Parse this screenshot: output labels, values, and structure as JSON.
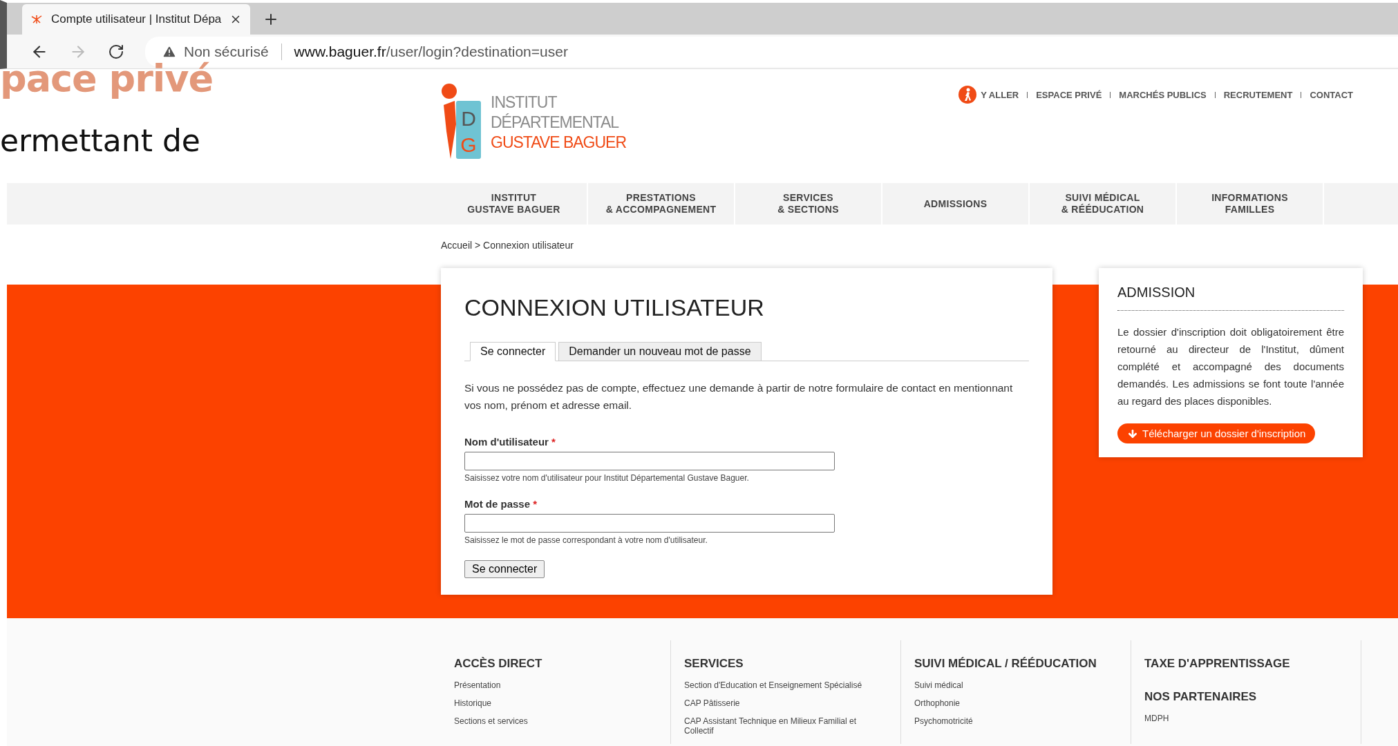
{
  "browser": {
    "tab_title": "Compte utilisateur | Institut Dépa",
    "security_label": "Non sécurisé",
    "url_host": "www.baguer.fr",
    "url_path": "/user/login?destination=user"
  },
  "slide_fragments": {
    "heading": "pace privé",
    "text": "ermettant de"
  },
  "logo": {
    "line_1": "INSTITUT",
    "line_2": "DÉPARTEMENTAL",
    "line_3": "GUSTAVE BAGUER",
    "letter_1": "D",
    "letter_2": "G"
  },
  "top_links": [
    {
      "label": "Y ALLER",
      "kind": "icon"
    },
    {
      "label": "ESPACE PRIVÉ",
      "kind": "plain"
    },
    {
      "label": "MARCHÉS PUBLICS",
      "kind": "plain"
    },
    {
      "label": "RECRUTEMENT",
      "kind": "plain"
    },
    {
      "label": "CONTACT",
      "kind": "plain"
    }
  ],
  "nav": [
    {
      "line_1": "INSTITUT",
      "line_2": "GUSTAVE BAGUER"
    },
    {
      "line_1": "PRESTATIONS",
      "line_2": "& ACCOMPAGNEMENT"
    },
    {
      "line_1": "SERVICES",
      "line_2": "& SECTIONS"
    },
    {
      "line_1": "ADMISSIONS"
    },
    {
      "line_1": "SUIVI MÉDICAL",
      "line_2": "& RÉÉDUCATION"
    },
    {
      "line_1": "INFORMATIONS",
      "line_2": "FAMILLES"
    }
  ],
  "breadcrumb": "Accueil > Connexion utilisateur",
  "login": {
    "title": "CONNEXION UTILISATEUR",
    "tabs": [
      {
        "label": "Se connecter",
        "selected": true
      },
      {
        "label": "Demander un nouveau mot de passe",
        "selected": false
      }
    ],
    "intro": "Si vous ne possédez pas de compte, effectuez une demande à partir de notre formulaire de contact en mentionnant vos nom, prénom et adresse email.",
    "fields": [
      {
        "label": "Nom d'utilisateur",
        "required_mark": "*",
        "help": "Saisissez votre nom d'utilisateur pour Institut Départemental Gustave Baguer."
      },
      {
        "label": "Mot de passe",
        "required_mark": "*",
        "help": "Saisissez le mot de passe correspondant à votre nom d'utilisateur."
      }
    ],
    "submit": "Se connecter"
  },
  "admission": {
    "title": "ADMISSION",
    "text": "Le dossier d'inscription doit obligatoirement être retourné au directeur de l'Institut, dûment complété et accompagné des documents demandés. Les admissions se font toute l'année au regard des places disponibles.",
    "button": "Télécharger un dossier d'inscription"
  },
  "footer": [
    {
      "sections": [
        {
          "heading": "ACCÈS DIRECT",
          "links": [
            "Présentation",
            "Historique",
            "Sections et services"
          ]
        }
      ]
    },
    {
      "sections": [
        {
          "heading": "SERVICES",
          "links": [
            "Section d'Education et Enseignement Spécialisé",
            "CAP Pâtisserie",
            "CAP Assistant Technique en Milieux Familial et Collectif"
          ]
        }
      ]
    },
    {
      "sections": [
        {
          "heading": "SUIVI MÉDICAL / RÉÉDUCATION",
          "links": [
            "Suivi médical",
            "Orthophonie",
            "Psychomotricité"
          ]
        }
      ]
    },
    {
      "sections": [
        {
          "heading": "TAXE D'APPRENTISSAGE"
        },
        {
          "heading": "NOS PARTENAIRES",
          "links": [
            "MDPH"
          ]
        }
      ]
    }
  ]
}
